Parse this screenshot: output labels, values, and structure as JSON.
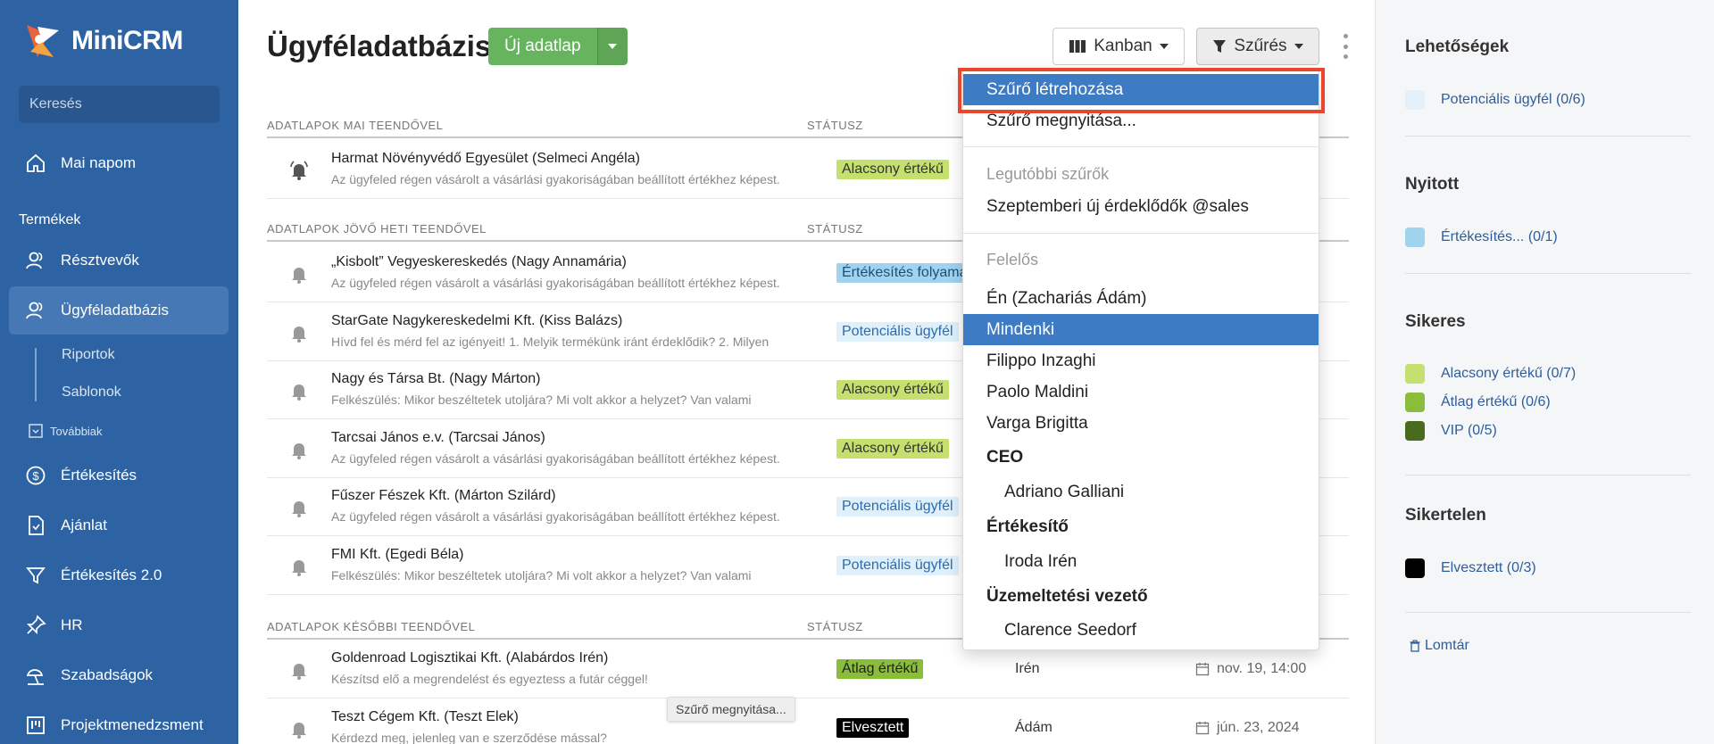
{
  "app": {
    "name": "MiniCRM"
  },
  "search": {
    "placeholder": "Keresés"
  },
  "sidebar": {
    "items": [
      {
        "label": "Mai napom",
        "icon": "home-icon"
      },
      {
        "label": "Résztvevők",
        "icon": "users-icon"
      },
      {
        "label": "Ügyféladatbázis",
        "icon": "users-icon"
      },
      {
        "label": "Értékesítés",
        "icon": "dollar-icon"
      },
      {
        "label": "Ajánlat",
        "icon": "document-icon"
      },
      {
        "label": "Értékesítés 2.0",
        "icon": "funnel-icon"
      },
      {
        "label": "HR",
        "icon": "pin-icon"
      },
      {
        "label": "Szabadságok",
        "icon": "vacation-icon"
      },
      {
        "label": "Projektmenedzsment",
        "icon": "board-icon"
      }
    ],
    "section_label": "Termékek",
    "sub_items": [
      "Riportok",
      "Sablonok"
    ],
    "more_label": "Továbbiak"
  },
  "header": {
    "title": "Ügyféladatbázis",
    "new_button": "Új adatlap",
    "kanban_button": "Kanban",
    "filter_button": "Szűrés"
  },
  "groups": [
    {
      "title": "ADATLAPOK MAI TEENDŐVEL",
      "status_header": "STÁTUSZ"
    },
    {
      "title": "ADATLAPOK JÖVŐ HETI TEENDŐVEL",
      "status_header": "STÁTUSZ"
    },
    {
      "title": "ADATLAPOK KÉSŐBBI TEENDŐVEL",
      "status_header": "STÁTUSZ"
    }
  ],
  "rows": [
    {
      "name": "Harmat Növényvédő Egyesület (Selmeci Angéla)",
      "desc": "Az ügyfeled régen vásárolt a vásárlási gyakoriságában beállított értékhez képest.",
      "status": "Alacsony értékű",
      "owner": "",
      "date": ""
    },
    {
      "name": "„Kisbolt” Vegyeskereskedés (Nagy Annamária)",
      "desc": "Az ügyfeled régen vásárolt a vásárlási gyakoriságában beállított értékhez képest.",
      "status": "Értékesítés folyamatban",
      "owner": "",
      "date": ""
    },
    {
      "name": "StarGate Nagykereskedelmi Kft. (Kiss Balázs)",
      "desc": "Hívd fel és mérd fel az igényeit! 1. Melyik termékünk iránt érdeklődik? 2. Milyen",
      "status": "Potenciális ügyfél",
      "owner": "",
      "date": ""
    },
    {
      "name": "Nagy és Társa Bt. (Nagy Márton)",
      "desc": "Felkészülés:  Mikor beszéltetek utoljára? Mi volt akkor a helyzet? Van valami",
      "status": "Alacsony értékű",
      "owner": "",
      "date": ""
    },
    {
      "name": "Tarcsai János e.v. (Tarcsai János)",
      "desc": "Az ügyfeled régen vásárolt a vásárlási gyakoriságában beállított értékhez képest.",
      "status": "Alacsony értékű",
      "owner": "",
      "date": ""
    },
    {
      "name": "Fűszer Fészek Kft. (Márton Szilárd)",
      "desc": "Az ügyfeled régen vásárolt a vásárlási gyakoriságában beállított értékhez képest.",
      "status": "Potenciális ügyfél",
      "owner": "",
      "date": ""
    },
    {
      "name": "FMI Kft. (Egedi Béla)",
      "desc": "Felkészülés:  Mikor beszéltetek utoljára? Mi volt akkor a helyzet? Van valami",
      "status": "Potenciális ügyfél",
      "owner": "",
      "date": ""
    },
    {
      "name": "Goldenroad Logisztikai Kft. (Alabárdos Irén)",
      "desc": "Készítsd elő a megrendelést és egyeztess a futár céggel!",
      "status": "Átlag értékű",
      "owner": "Irén",
      "date": "nov. 19, 14:00"
    },
    {
      "name": "Teszt Cégem Kft. (Teszt Elek)",
      "desc": "Kérdezd meg, jelenleg van e szerződése mással?",
      "status": "Elvesztett",
      "owner": "Ádám",
      "date": "jún. 23, 2024"
    }
  ],
  "tooltip": "Szűrő megnyitása...",
  "dropdown": {
    "items": [
      "Szűrő létrehozása",
      "Szűrő megnyitása...",
      "Legutóbbi szűrők",
      "Szeptemberi új érdeklődők @sales",
      "Felelős",
      "Én (Zachariás Ádám)",
      "Mindenki",
      "Filippo Inzaghi",
      "Paolo Maldini",
      "Varga Brigitta",
      "CEO",
      "Adriano Galliani",
      "Értékesítő",
      "Iroda Irén",
      "Üzemeltetési vezető",
      "Clarence Seedorf"
    ]
  },
  "right_panel": {
    "sections": [
      {
        "title": "Lehetőségek",
        "items": [
          {
            "label": "Potenciális ügyfél (0/6)",
            "color": "#e4f1fb"
          }
        ]
      },
      {
        "title": "Nyitott",
        "items": [
          {
            "label": "Értékesítés... (0/1)",
            "color": "#9fd3ee"
          }
        ]
      },
      {
        "title": "Sikeres",
        "items": [
          {
            "label": "Alacsony értékű (0/7)",
            "color": "#c5e06f"
          },
          {
            "label": "Átlag értékű (0/6)",
            "color": "#8bbd3d"
          },
          {
            "label": "VIP (0/5)",
            "color": "#4a6a1f"
          }
        ]
      },
      {
        "title": "Sikertelen",
        "items": [
          {
            "label": "Elvesztett (0/3)",
            "color": "#000000"
          }
        ]
      }
    ],
    "trash_label": "Lomtár"
  },
  "colors": {
    "sidebar": "#2e63a3",
    "highlight": "#3d7bc4",
    "accent_green": "#67b45f",
    "callout_red": "#e8472f"
  }
}
